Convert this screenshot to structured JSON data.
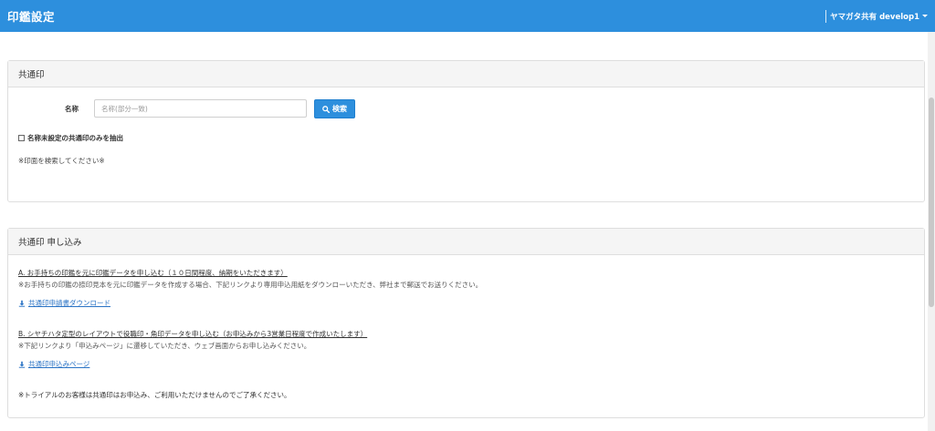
{
  "header": {
    "title": "印鑑設定",
    "user_label": "ヤマガタ共有 develop1"
  },
  "common_seal": {
    "heading": "共通印",
    "name_label": "名称",
    "name_placeholder": "名称(部分一致)",
    "search_button": "検索",
    "filter_checkbox_label": "名称未設定の共通印のみを抽出",
    "filter_checked": false,
    "empty_note": "※印面を検索してください※"
  },
  "application": {
    "heading": "共通印 申し込み",
    "section_a_title": "A. お手持ちの印鑑を元に印鑑データを申し込む（１０日間程度、納期をいただきます）",
    "section_a_desc": "※お手持ちの印鑑の捺印見本を元に印鑑データを作成する場合、下記リンクより専用申込用紙をダウンローいただき、弊社まで郵送でお送りください。",
    "section_a_link": "共通印申請書ダウンロード",
    "section_b_title": "B. シヤチハタ定型のレイアウトで役職印・角印データを申し込む（お申込みから3営業日程度で作成いたします）",
    "section_b_desc": "※下記リンクより「申込みページ」に遷移していただき、ウェブ画面からお申し込みください。",
    "section_b_link": "共通印申込みページ",
    "trial_note": "※トライアルのお客様は共通印はお申込み、ご利用いただけませんのでご了承ください。"
  },
  "colors": {
    "primary": "#2d8fdd",
    "link": "#2a73c5",
    "card_header_bg": "#f5f5f5"
  },
  "icons": {
    "search": "magnifier-icon",
    "download": "download-icon",
    "user_menu": "caret-down-icon"
  }
}
